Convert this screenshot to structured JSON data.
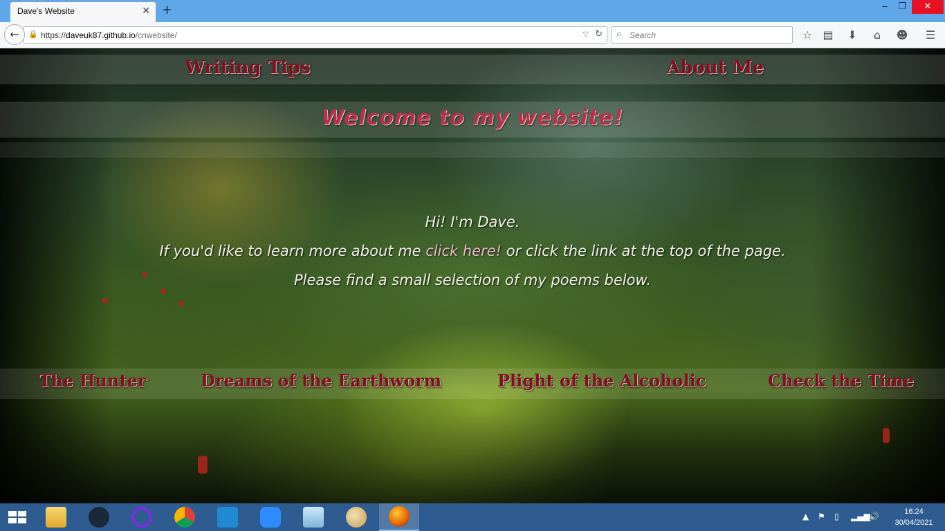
{
  "browser": {
    "tab_title": "Dave's Website",
    "tab_close": "✕",
    "new_tab": "+",
    "minimize": "‒",
    "maximize": "❐",
    "close": "✕",
    "url_scheme": "https://",
    "url_host": "daveuk87.github.io",
    "url_path": "/cnwebsite/",
    "search_placeholder": "Search"
  },
  "toolbar_icons": [
    "bookmark-star-icon",
    "reading-list-icon",
    "download-icon",
    "home-icon",
    "smiley-icon",
    "menu-icon"
  ],
  "page": {
    "nav": {
      "writing_tips": "Writing Tips",
      "about_me": "About Me"
    },
    "welcome": "Welcome to my website!",
    "intro": {
      "line1": "Hi! I'm Dave.",
      "line2_before": "If you'd like to learn more about me ",
      "line2_link": "click here!",
      "line2_after": " or click the link at the top of the page.",
      "line3": "Please find a small selection of my poems below."
    },
    "poems": [
      "The Hunter",
      "Dreams of the Earthworm",
      "Plight of the Alcoholic",
      "Check the Time"
    ]
  },
  "taskbar": {
    "apps": [
      "file-explorer",
      "steam",
      "cortana",
      "chrome",
      "vscode",
      "zoom",
      "notepad",
      "paint",
      "firefox"
    ],
    "active_app": "firefox",
    "time": "16:24",
    "date": "30/04/2021"
  }
}
